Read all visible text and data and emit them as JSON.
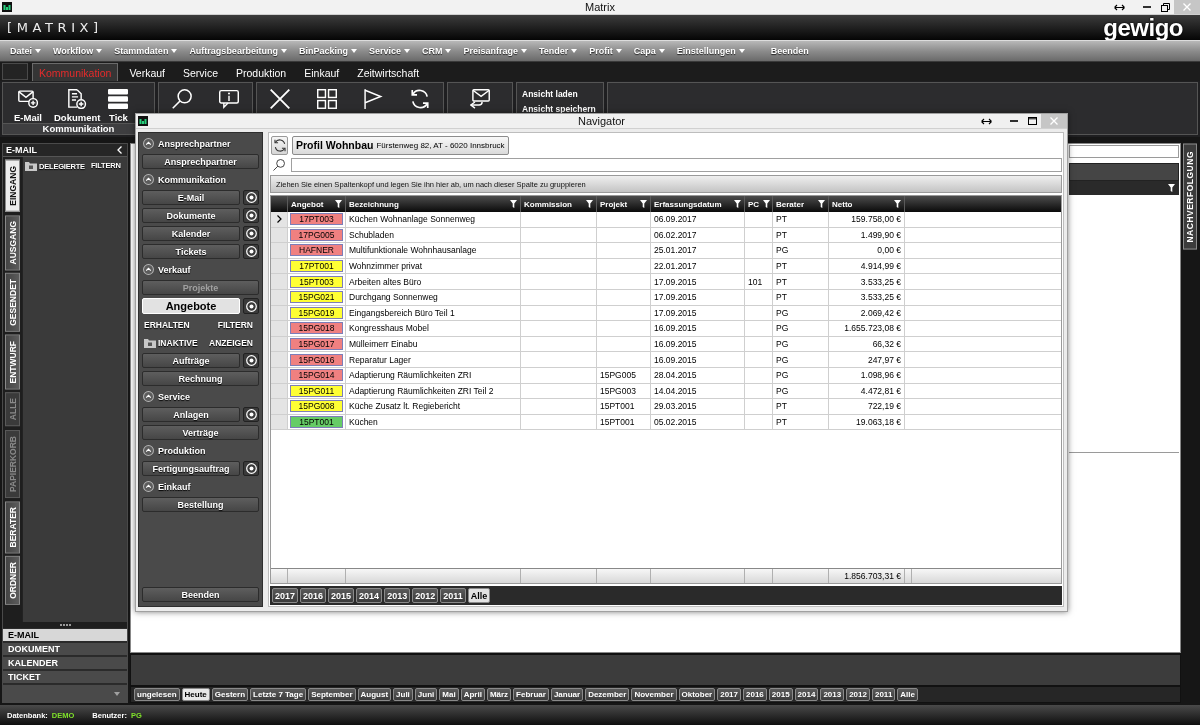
{
  "window": {
    "title": "Matrix"
  },
  "header": {
    "logo": "[MATRIX]",
    "brand": "gewigo"
  },
  "menu": [
    {
      "label": "Datei",
      "dropdown": true
    },
    {
      "label": "Workflow",
      "dropdown": true
    },
    {
      "label": "Stammdaten",
      "dropdown": true
    },
    {
      "label": "Auftragsbearbeitung",
      "dropdown": true
    },
    {
      "label": "BinPacking",
      "dropdown": true
    },
    {
      "label": "Service",
      "dropdown": true
    },
    {
      "label": "CRM",
      "dropdown": true
    },
    {
      "label": "Preisanfrage",
      "dropdown": true
    },
    {
      "label": "Tender",
      "dropdown": true
    },
    {
      "label": "Profit",
      "dropdown": true
    },
    {
      "label": "Capa",
      "dropdown": true
    },
    {
      "label": "Einstellungen",
      "dropdown": true
    },
    {
      "label": "Beenden",
      "dropdown": false
    }
  ],
  "ribbon_tabs": [
    {
      "label": "Kommunikation",
      "selected": true
    },
    {
      "label": "Verkauf",
      "selected": false
    },
    {
      "label": "Service",
      "selected": false
    },
    {
      "label": "Produktion",
      "selected": false
    },
    {
      "label": "Einkauf",
      "selected": false
    },
    {
      "label": "Zeitwirtschaft",
      "selected": false
    }
  ],
  "ribbon": {
    "groups": [
      {
        "label": "Kommunikation",
        "buttons": [
          {
            "kind": "email",
            "label": "E-Mail"
          },
          {
            "kind": "document",
            "label": "Dokument"
          },
          {
            "kind": "ticket",
            "label": "Tick"
          }
        ]
      },
      {
        "buttons": [
          {
            "kind": "search"
          },
          {
            "kind": "info"
          }
        ]
      },
      {
        "buttons": [
          {
            "kind": "delete"
          },
          {
            "kind": "category"
          },
          {
            "kind": "flag"
          },
          {
            "kind": "refresh"
          }
        ]
      },
      {
        "buttons": [
          {
            "kind": "reply"
          }
        ]
      }
    ],
    "links": [
      "Ansicht laden",
      "Ansicht speichern"
    ]
  },
  "left_panel": {
    "title": "E-MAIL",
    "vertical_tabs": [
      {
        "label": "EINGANG",
        "selected": true,
        "disabled": false
      },
      {
        "label": "AUSGANG",
        "selected": false,
        "disabled": false
      },
      {
        "label": "GESENDET",
        "selected": false,
        "disabled": false
      },
      {
        "label": "ENTWURF",
        "selected": false,
        "disabled": false
      },
      {
        "label": "ALLE",
        "selected": false,
        "disabled": true
      },
      {
        "label": "PAPIERKORB",
        "selected": false,
        "disabled": true
      },
      {
        "label": "BERATER",
        "selected": false,
        "disabled": false
      },
      {
        "label": "ORDNER",
        "selected": false,
        "disabled": false
      }
    ],
    "options": [
      {
        "label": "DELEGIERTE",
        "folder": true
      },
      {
        "label": "FILTERN",
        "folder": false
      }
    ],
    "modules": [
      {
        "label": "E-MAIL",
        "selected": true
      },
      {
        "label": "DOKUMENT",
        "selected": false
      },
      {
        "label": "KALENDER",
        "selected": false
      },
      {
        "label": "TICKET",
        "selected": false
      }
    ]
  },
  "navigator": {
    "title": "Navigator",
    "sections": [
      {
        "label": "Ansprechpartner",
        "expanded": true,
        "items": [
          {
            "kind": "button",
            "label": "Ansprechpartner",
            "selected": false,
            "disabled": false,
            "add": false
          }
        ]
      },
      {
        "label": "Kommunikation",
        "expanded": true,
        "items": [
          {
            "kind": "button",
            "label": "E-Mail",
            "selected": false,
            "disabled": false,
            "add": true
          },
          {
            "kind": "button",
            "label": "Dokumente",
            "selected": false,
            "disabled": false,
            "add": true
          },
          {
            "kind": "button",
            "label": "Kalender",
            "selected": false,
            "disabled": false,
            "add": true
          },
          {
            "kind": "button",
            "label": "Tickets",
            "selected": false,
            "disabled": false,
            "add": true
          }
        ]
      },
      {
        "label": "Verkauf",
        "expanded": true,
        "items": [
          {
            "kind": "button",
            "label": "Projekte",
            "selected": false,
            "disabled": true,
            "add": false
          },
          {
            "kind": "button",
            "label": "Angebote",
            "selected": true,
            "disabled": false,
            "add": true
          },
          {
            "kind": "options",
            "options": [
              {
                "label": "ERHALTEN",
                "folder": false
              },
              {
                "label": "FILTERN",
                "folder": false
              }
            ]
          },
          {
            "kind": "options",
            "options": [
              {
                "label": "INAKTIVE",
                "folder": true
              },
              {
                "label": "ANZEIGEN",
                "folder": false
              }
            ]
          },
          {
            "kind": "button",
            "label": "Aufträge",
            "selected": false,
            "disabled": false,
            "add": true
          },
          {
            "kind": "button",
            "label": "Rechnung",
            "selected": false,
            "disabled": false,
            "add": false
          }
        ]
      },
      {
        "label": "Service",
        "expanded": true,
        "items": [
          {
            "kind": "button",
            "label": "Anlagen",
            "selected": false,
            "disabled": false,
            "add": true
          },
          {
            "kind": "button",
            "label": "Verträge",
            "selected": false,
            "disabled": false,
            "add": false
          }
        ]
      },
      {
        "label": "Produktion",
        "expanded": true,
        "items": [
          {
            "kind": "button",
            "label": "Fertigungsauftrag",
            "selected": false,
            "disabled": false,
            "add": true
          }
        ]
      },
      {
        "label": "Einkauf",
        "expanded": true,
        "items": [
          {
            "kind": "button",
            "label": "Bestellung",
            "selected": false,
            "disabled": false,
            "add": false
          }
        ]
      }
    ],
    "exit": "Beenden",
    "profile": {
      "name": "Profil Wohnbau",
      "address": "Fürstenweg 82, AT - 6020 Innsbruck"
    },
    "group_hint": "Ziehen Sie einen Spaltenkopf und legen Sie ihn hier ab, um nach dieser Spalte zu gruppieren",
    "table": {
      "columns": [
        "Angebot",
        "Bezeichnung",
        "Kommission",
        "Projekt",
        "Erfassungsdatum",
        "PC",
        "Berater",
        "Netto"
      ],
      "rows": [
        {
          "current": true,
          "angebot": "17PT003",
          "color": "#f08080",
          "bezeichnung": "Küchen Wohnanlage Sonnenweg",
          "erfassungsdatum": "06.09.2017",
          "berater": "PT",
          "netto": "159.758,00 €"
        },
        {
          "current": false,
          "angebot": "17PG005",
          "color": "#f08080",
          "bezeichnung": "Schubladen",
          "erfassungsdatum": "06.02.2017",
          "berater": "PT",
          "netto": "1.499,90 €"
        },
        {
          "current": false,
          "angebot": "HAFNER",
          "color": "#f08080",
          "bezeichnung": "Multifunktionale Wohnhausanlage",
          "erfassungsdatum": "25.01.2017",
          "berater": "PG",
          "netto": "0,00 €"
        },
        {
          "current": false,
          "angebot": "17PT001",
          "color": "#ffff33",
          "bezeichnung": "Wohnzimmer privat",
          "erfassungsdatum": "22.01.2017",
          "berater": "PT",
          "netto": "4.914,99 €"
        },
        {
          "current": false,
          "angebot": "15PT003",
          "color": "#ffff33",
          "bezeichnung": "Arbeiten altes Büro",
          "erfassungsdatum": "17.09.2015",
          "pc": "101",
          "berater": "PT",
          "netto": "3.533,25 €"
        },
        {
          "current": false,
          "angebot": "15PG021",
          "color": "#ffff33",
          "bezeichnung": "Durchgang Sonnenweg",
          "erfassungsdatum": "17.09.2015",
          "berater": "PT",
          "netto": "3.533,25 €"
        },
        {
          "current": false,
          "angebot": "15PG019",
          "color": "#ffff33",
          "bezeichnung": "Eingangsbereich Büro Teil 1",
          "erfassungsdatum": "17.09.2015",
          "berater": "PG",
          "netto": "2.069,42 €"
        },
        {
          "current": false,
          "angebot": "15PG018",
          "color": "#f08080",
          "bezeichnung": "Kongresshaus Mobel",
          "erfassungsdatum": "16.09.2015",
          "berater": "PG",
          "netto": "1.655.723,08 €"
        },
        {
          "current": false,
          "angebot": "15PG017",
          "color": "#f08080",
          "bezeichnung": "Mülleimerr Einabu",
          "erfassungsdatum": "16.09.2015",
          "berater": "PG",
          "netto": "66,32 €"
        },
        {
          "current": false,
          "angebot": "15PG016",
          "color": "#f08080",
          "bezeichnung": "Reparatur Lager",
          "erfassungsdatum": "16.09.2015",
          "berater": "PG",
          "netto": "247,97 €"
        },
        {
          "current": false,
          "angebot": "15PG014",
          "color": "#f08080",
          "bezeichnung": "Adaptierung Räumlichkeiten ZRI",
          "projekt": "15PG005",
          "erfassungsdatum": "28.04.2015",
          "berater": "PG",
          "netto": "1.098,96 €"
        },
        {
          "current": false,
          "angebot": "15PG011",
          "color": "#ffff33",
          "bezeichnung": "Adaptierung Räumlichkeiten ZRI Teil 2",
          "projekt": "15PG003",
          "erfassungsdatum": "14.04.2015",
          "berater": "PG",
          "netto": "4.472,81 €"
        },
        {
          "current": false,
          "angebot": "15PG008",
          "color": "#ffff33",
          "bezeichnung": "Küche Zusatz lt. Regiebericht",
          "projekt": "15PT001",
          "erfassungsdatum": "29.03.2015",
          "berater": "PT",
          "netto": "722,19 €"
        },
        {
          "current": false,
          "angebot": "15PT001",
          "color": "#66cc66",
          "bezeichnung": "Küchen",
          "projekt": "15PT001",
          "erfassungsdatum": "05.02.2015",
          "berater": "PT",
          "netto": "19.063,18 €"
        }
      ],
      "total": "1.856.703,31 €"
    },
    "years": [
      {
        "label": "2017",
        "selected": false
      },
      {
        "label": "2016",
        "selected": false
      },
      {
        "label": "2015",
        "selected": false
      },
      {
        "label": "2014",
        "selected": false
      },
      {
        "label": "2013",
        "selected": false
      },
      {
        "label": "2012",
        "selected": false
      },
      {
        "label": "2011",
        "selected": false
      },
      {
        "label": "Alle",
        "selected": true
      }
    ]
  },
  "date_filters": [
    {
      "label": "ungelesen",
      "selected": false
    },
    {
      "label": "Heute",
      "selected": true
    },
    {
      "label": "Gestern",
      "selected": false
    },
    {
      "label": "Letzte 7 Tage",
      "selected": false
    },
    {
      "label": "September",
      "selected": false
    },
    {
      "label": "August",
      "selected": false
    },
    {
      "label": "Juli",
      "selected": false
    },
    {
      "label": "Juni",
      "selected": false
    },
    {
      "label": "Mai",
      "selected": false
    },
    {
      "label": "April",
      "selected": false
    },
    {
      "label": "März",
      "selected": false
    },
    {
      "label": "Februar",
      "selected": false
    },
    {
      "label": "Januar",
      "selected": false
    },
    {
      "label": "Dezember",
      "selected": false
    },
    {
      "label": "November",
      "selected": false
    },
    {
      "label": "Oktober",
      "selected": false
    },
    {
      "label": "2017",
      "selected": false
    },
    {
      "label": "2016",
      "selected": false
    },
    {
      "label": "2015",
      "selected": false
    },
    {
      "label": "2014",
      "selected": false
    },
    {
      "label": "2013",
      "selected": false
    },
    {
      "label": "2012",
      "selected": false
    },
    {
      "label": "2011",
      "selected": false
    },
    {
      "label": "Alle",
      "selected": false
    }
  ],
  "side_tab": {
    "label": "NACHVERFOLGUNG"
  },
  "status_bar": [
    {
      "label": "Datenbank:",
      "value": "DEMO"
    },
    {
      "label": "Benutzer:",
      "value": "PG"
    }
  ]
}
